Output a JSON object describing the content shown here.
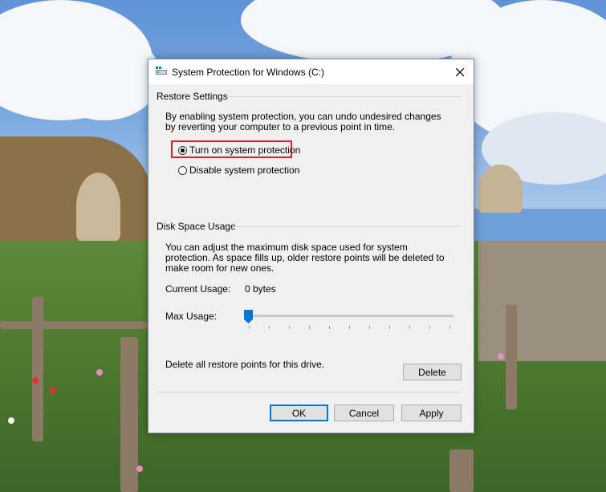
{
  "window": {
    "title": "System Protection for Windows (C:)",
    "icon": "drive-icon",
    "close_icon": "close-icon"
  },
  "restore_settings": {
    "group_label": "Restore Settings",
    "description": "By enabling system protection, you can undo undesired changes by reverting your computer to a previous point in time.",
    "options": [
      {
        "label": "Turn on system protection",
        "selected": true
      },
      {
        "label": "Disable system protection",
        "selected": false
      }
    ]
  },
  "disk_space": {
    "group_label": "Disk Space Usage",
    "description": "You can adjust the maximum disk space used for system protection. As space fills up, older restore points will be deleted to make room for new ones.",
    "current_usage_label": "Current Usage:",
    "current_usage_value": "0 bytes",
    "max_usage_label": "Max Usage:",
    "max_usage_level": 0,
    "delete_text": "Delete all restore points for this drive.",
    "delete_button": "Delete"
  },
  "footer": {
    "ok": "OK",
    "cancel": "Cancel",
    "apply": "Apply"
  },
  "colors": {
    "accent": "#0078d7",
    "highlight_box": "#e0202e",
    "dialog_bg": "#f0f0f0"
  }
}
